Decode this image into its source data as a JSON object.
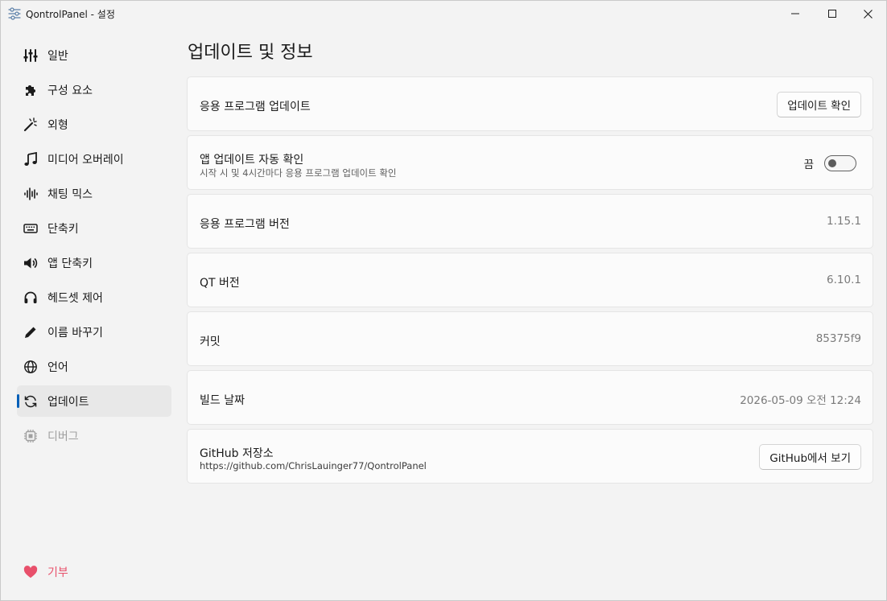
{
  "window": {
    "title": "QontrolPanel - 설정"
  },
  "sidebar": {
    "items": [
      {
        "label": "일반",
        "icon": "sliders-icon"
      },
      {
        "label": "구성 요소",
        "icon": "puzzle-icon"
      },
      {
        "label": "외형",
        "icon": "magic-wand-icon"
      },
      {
        "label": "미디어 오버레이",
        "icon": "music-note-icon"
      },
      {
        "label": "채팅 믹스",
        "icon": "waveform-icon"
      },
      {
        "label": "단축키",
        "icon": "keyboard-icon"
      },
      {
        "label": "앱 단축키",
        "icon": "speaker-icon"
      },
      {
        "label": "헤드셋 제어",
        "icon": "headset-icon"
      },
      {
        "label": "이름 바꾸기",
        "icon": "pencil-icon"
      },
      {
        "label": "언어",
        "icon": "globe-icon"
      },
      {
        "label": "업데이트",
        "icon": "refresh-icon",
        "active": true
      },
      {
        "label": "디버그",
        "icon": "chip-icon",
        "disabled": true
      }
    ],
    "donate": {
      "label": "기부",
      "icon": "heart-icon",
      "color": "#e8506b"
    }
  },
  "main": {
    "title": "업데이트 및 정보",
    "app_update": {
      "label": "응용 프로그램 업데이트",
      "button": "업데이트 확인"
    },
    "auto_check": {
      "label": "앱 업데이트 자동 확인",
      "description": "시작 시 및 4시간마다 응용 프로그램 업데이트 확인",
      "state": "끔",
      "enabled": false
    },
    "app_version": {
      "label": "응용 프로그램 버전",
      "value": "1.15.1"
    },
    "qt_version": {
      "label": "QT 버전",
      "value": "6.10.1"
    },
    "commit": {
      "label": "커밋",
      "value": "85375f9"
    },
    "build_date": {
      "label": "빌드 날짜",
      "value": "2026-05-09 오전 12:24"
    },
    "github": {
      "label": "GitHub 저장소",
      "url": "https://github.com/ChrisLauinger77/QontrolPanel",
      "button": "GitHub에서 보기"
    }
  },
  "colors": {
    "accent": "#005fb8",
    "heart": "#e8506b"
  }
}
